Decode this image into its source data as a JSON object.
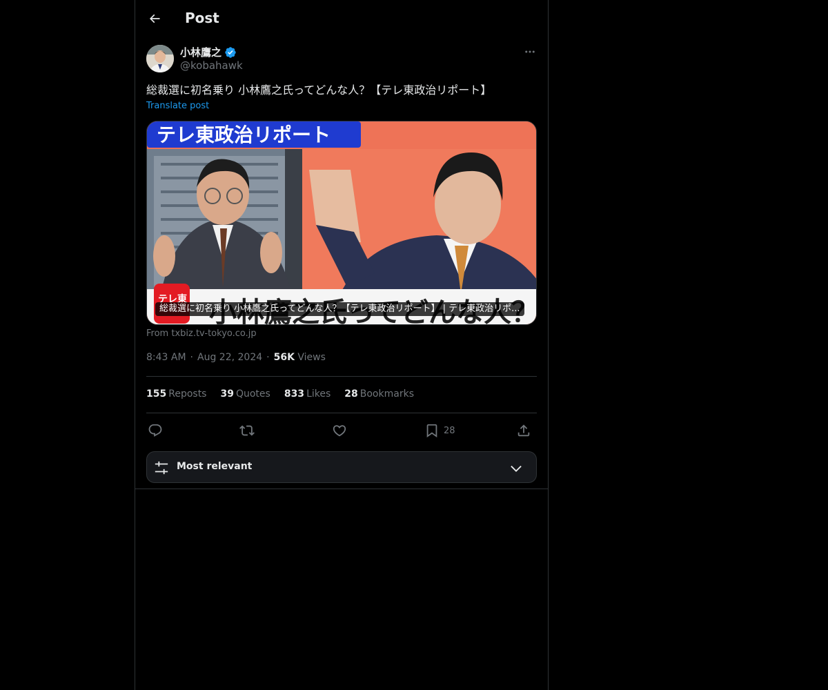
{
  "header": {
    "title": "Post",
    "back_icon": "back-arrow-icon"
  },
  "post": {
    "author_name": "小林鷹之",
    "verified_icon": "verified-badge-icon",
    "handle": "@kobahawk",
    "text": "総裁選に初名乗り 小林鷹之氏ってどんな人？【テレ東政治リポート】",
    "translate_label": "Translate post",
    "media": {
      "banner_text": "テレ東政治リポート",
      "logo_text": "テレ東",
      "caption_overlay": "小林鷹之氏ってどんな人？",
      "card_title": "総裁選に初名乗り 小林鷹之氏ってどんな人？【テレ東政治リポート】 | テレ東政治リポ..."
    },
    "source": "From txbiz.tv-tokyo.co.jp",
    "time": "8:43 AM",
    "date": "Aug 22, 2024",
    "views_count": "56K",
    "views_label": "Views"
  },
  "stats": [
    {
      "count": "155",
      "label": "Reposts"
    },
    {
      "count": "39",
      "label": "Quotes"
    },
    {
      "count": "833",
      "label": "Likes"
    },
    {
      "count": "28",
      "label": "Bookmarks"
    }
  ],
  "actions": {
    "reply_icon": "reply-icon",
    "repost_icon": "repost-icon",
    "like_icon": "heart-icon",
    "bookmark_icon": "bookmark-icon",
    "bookmark_count": "28",
    "share_icon": "share-icon"
  },
  "sort": {
    "label": "Most relevant",
    "icon": "sliders-icon",
    "chevron": "chevron-down-icon"
  },
  "colors": {
    "background": "#000000",
    "text_primary": "#e7e9ea",
    "text_secondary": "#71767b",
    "link": "#1d9bf0",
    "border": "#2f3336",
    "verified": "#1d9bf0"
  }
}
